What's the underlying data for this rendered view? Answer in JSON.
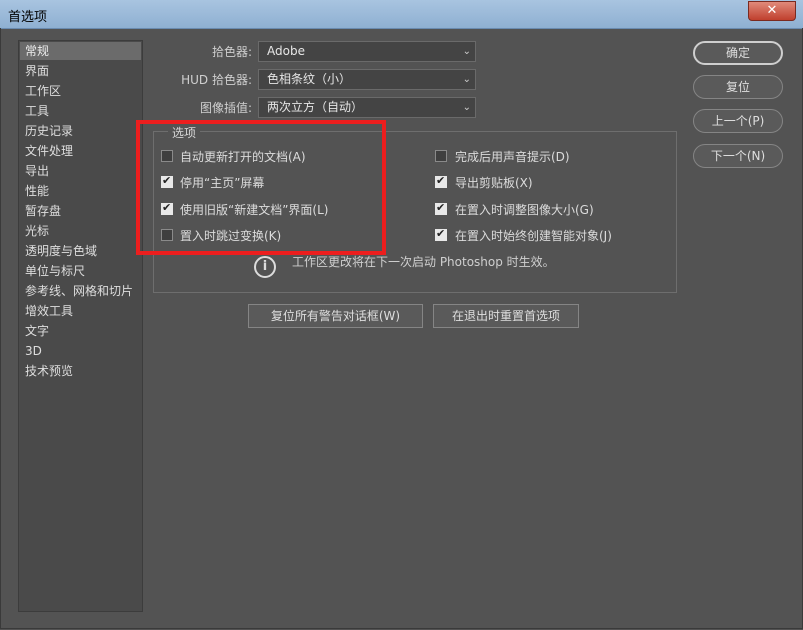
{
  "window": {
    "title": "首选项",
    "close_glyph": "✕"
  },
  "sidebar": {
    "items": [
      {
        "label": "常规",
        "selected": true
      },
      {
        "label": "界面"
      },
      {
        "label": "工作区"
      },
      {
        "label": "工具"
      },
      {
        "label": "历史记录"
      },
      {
        "label": "文件处理"
      },
      {
        "label": "导出"
      },
      {
        "label": "性能"
      },
      {
        "label": "暂存盘"
      },
      {
        "label": "光标"
      },
      {
        "label": "透明度与色域"
      },
      {
        "label": "单位与标尺"
      },
      {
        "label": "参考线、网格和切片"
      },
      {
        "label": "增效工具"
      },
      {
        "label": "文字"
      },
      {
        "label": "3D"
      },
      {
        "label": "技术预览"
      }
    ]
  },
  "fields": {
    "color_picker": {
      "label": "拾色器:",
      "value": "Adobe"
    },
    "hud_color_picker": {
      "label": "HUD 拾色器:",
      "value": "色相条纹（小）"
    },
    "image_interpolation": {
      "label": "图像插值:",
      "value": "两次立方（自动）"
    }
  },
  "options": {
    "title": "选项",
    "left": [
      {
        "label": "自动更新打开的文档(A)",
        "checked": false
      },
      {
        "label": "停用“主页”屏幕",
        "checked": true
      },
      {
        "label": "使用旧版“新建文档”界面(L)",
        "checked": true
      },
      {
        "label": "置入时跳过变换(K)",
        "checked": false
      }
    ],
    "right": [
      {
        "label": "完成后用声音提示(D)",
        "checked": false
      },
      {
        "label": "导出剪贴板(X)",
        "checked": true
      },
      {
        "label": "在置入时调整图像大小(G)",
        "checked": true
      },
      {
        "label": "在置入时始终创建智能对象(J)",
        "checked": true
      }
    ],
    "info": "工作区更改将在下一次启动 Photoshop 时生效。"
  },
  "buttons": {
    "reset_warnings": "复位所有警告对话框(W)",
    "reset_on_quit": "在退出时重置首选项",
    "ok": "确定",
    "reset": "复位",
    "prev": "上一个(P)",
    "next": "下一个(N)"
  },
  "colors": {
    "highlight_box": "#ec1e1e",
    "background": "#535353"
  },
  "icons": {
    "info": "info-icon",
    "chevron": "chevron-down-icon",
    "check": "checkmark-icon"
  }
}
